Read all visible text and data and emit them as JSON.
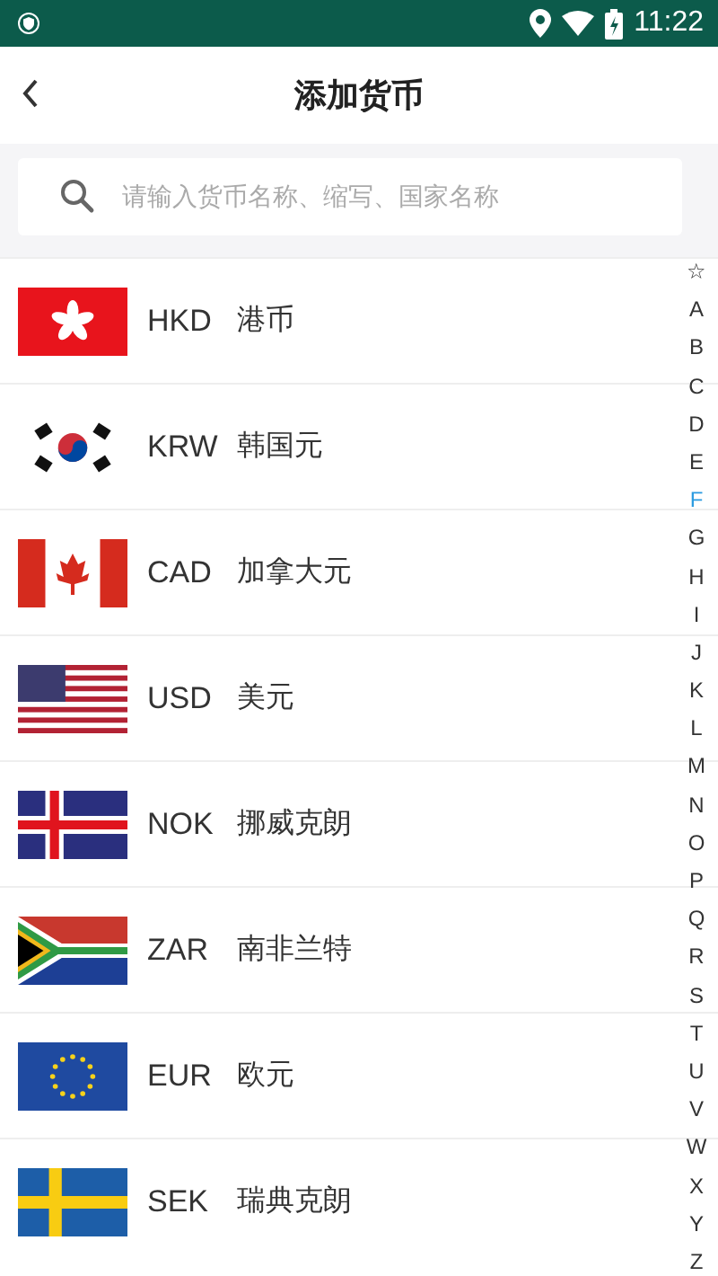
{
  "status_bar": {
    "time": "11:22"
  },
  "header": {
    "title": "添加货币"
  },
  "search": {
    "placeholder": "请输入货币名称、缩写、国家名称"
  },
  "currencies": [
    {
      "code": "HKD",
      "name": "港币",
      "kind": "hk"
    },
    {
      "code": "KRW",
      "name": "韩国元",
      "kind": "kr"
    },
    {
      "code": "CAD",
      "name": "加拿大元",
      "kind": "ca"
    },
    {
      "code": "USD",
      "name": "美元",
      "kind": "us"
    },
    {
      "code": "NOK",
      "name": "挪威克朗",
      "kind": "is"
    },
    {
      "code": "ZAR",
      "name": "南非兰特",
      "kind": "za"
    },
    {
      "code": "EUR",
      "name": "欧元",
      "kind": "eu"
    },
    {
      "code": "SEK",
      "name": "瑞典克朗",
      "kind": "se"
    }
  ],
  "index": [
    {
      "label": "☆",
      "selected": false
    },
    {
      "label": "A",
      "selected": false
    },
    {
      "label": "B",
      "selected": false
    },
    {
      "label": "C",
      "selected": false
    },
    {
      "label": "D",
      "selected": false
    },
    {
      "label": "E",
      "selected": false
    },
    {
      "label": "F",
      "selected": true
    },
    {
      "label": "G",
      "selected": false
    },
    {
      "label": "H",
      "selected": false
    },
    {
      "label": "I",
      "selected": false
    },
    {
      "label": "J",
      "selected": false
    },
    {
      "label": "K",
      "selected": false
    },
    {
      "label": "L",
      "selected": false
    },
    {
      "label": "M",
      "selected": false
    },
    {
      "label": "N",
      "selected": false
    },
    {
      "label": "O",
      "selected": false
    },
    {
      "label": "P",
      "selected": false
    },
    {
      "label": "Q",
      "selected": false
    },
    {
      "label": "R",
      "selected": false
    },
    {
      "label": "S",
      "selected": false
    },
    {
      "label": "T",
      "selected": false
    },
    {
      "label": "U",
      "selected": false
    },
    {
      "label": "V",
      "selected": false
    },
    {
      "label": "W",
      "selected": false
    },
    {
      "label": "X",
      "selected": false
    },
    {
      "label": "Y",
      "selected": false
    },
    {
      "label": "Z",
      "selected": false
    }
  ]
}
